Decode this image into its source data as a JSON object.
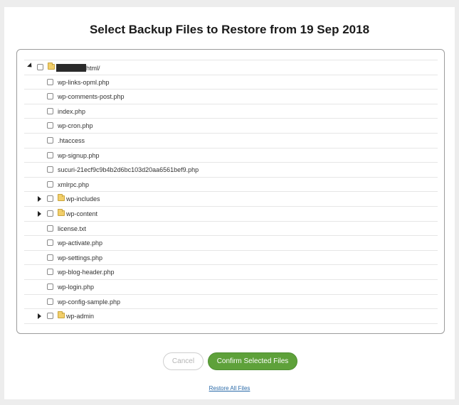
{
  "dialog": {
    "title": "Select Backup Files to Restore from 19 Sep 2018"
  },
  "tree": {
    "root": {
      "label_suffix": "html/",
      "redacted": true,
      "expanded": true
    },
    "items": [
      {
        "label": "wp-links-opml.php",
        "type": "file"
      },
      {
        "label": "wp-comments-post.php",
        "type": "file"
      },
      {
        "label": "index.php",
        "type": "file"
      },
      {
        "label": "wp-cron.php",
        "type": "file"
      },
      {
        "label": ".htaccess",
        "type": "file"
      },
      {
        "label": "wp-signup.php",
        "type": "file"
      },
      {
        "label": "sucuri-21ecf9c9b4b2d6bc103d20aa6561bef9.php",
        "type": "file"
      },
      {
        "label": "xmlrpc.php",
        "type": "file"
      },
      {
        "label": "wp-includes",
        "type": "folder"
      },
      {
        "label": "wp-content",
        "type": "folder"
      },
      {
        "label": "license.txt",
        "type": "file"
      },
      {
        "label": "wp-activate.php",
        "type": "file"
      },
      {
        "label": "wp-settings.php",
        "type": "file"
      },
      {
        "label": "wp-blog-header.php",
        "type": "file"
      },
      {
        "label": "wp-login.php",
        "type": "file"
      },
      {
        "label": "wp-config-sample.php",
        "type": "file"
      },
      {
        "label": "wp-admin",
        "type": "folder"
      }
    ]
  },
  "buttons": {
    "cancel_label": "Cancel",
    "confirm_label": "Confirm Selected Files"
  },
  "links": {
    "restore_all_label": "Restore All Files"
  },
  "colors": {
    "confirm_bg": "#5ea13a",
    "link": "#2a6aa8"
  }
}
